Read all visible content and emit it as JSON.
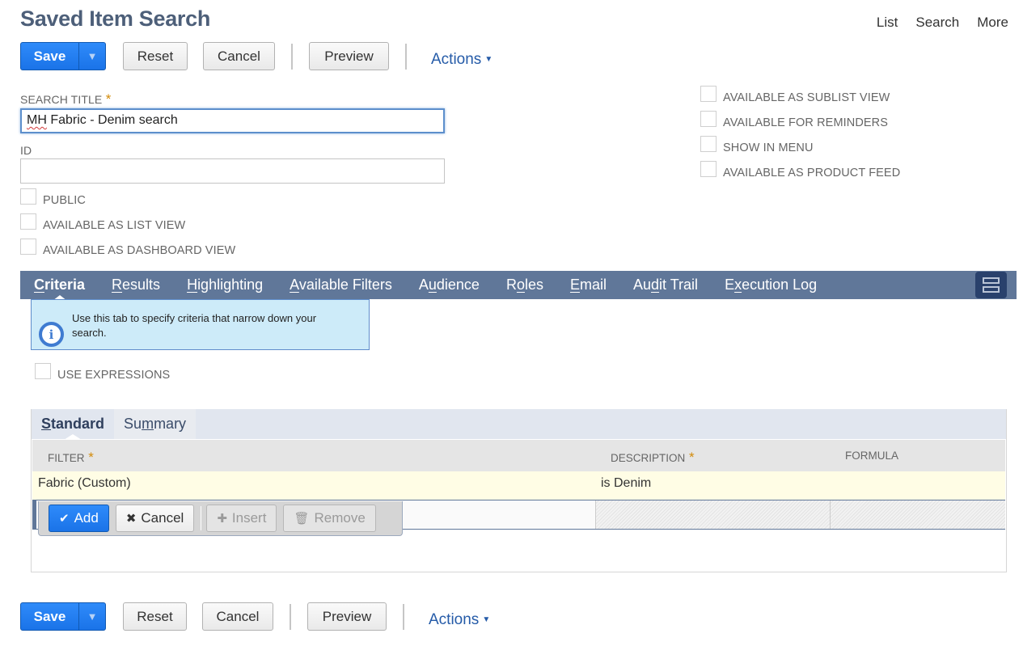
{
  "page": {
    "title": "Saved Item Search"
  },
  "top_links": [
    "List",
    "Search",
    "More"
  ],
  "toolbar": {
    "save_label": "Save",
    "reset_label": "Reset",
    "cancel_label": "Cancel",
    "preview_label": "Preview",
    "actions_label": "Actions"
  },
  "form": {
    "search_title_label": "SEARCH TITLE",
    "search_title_value": "MH Fabric - Denim search",
    "search_title_misspelled": "MH",
    "search_title_rest": " Fabric - Denim search",
    "id_label": "ID",
    "id_value": "",
    "left_checkboxes": [
      {
        "label": "PUBLIC",
        "checked": false
      },
      {
        "label": "AVAILABLE AS LIST VIEW",
        "checked": false
      },
      {
        "label": "AVAILABLE AS DASHBOARD VIEW",
        "checked": false
      }
    ],
    "right_checkboxes": [
      {
        "label": "AVAILABLE AS SUBLIST VIEW",
        "checked": false
      },
      {
        "label": "AVAILABLE FOR REMINDERS",
        "checked": false
      },
      {
        "label": "SHOW IN MENU",
        "checked": false
      },
      {
        "label": "AVAILABLE AS PRODUCT FEED",
        "checked": false
      }
    ]
  },
  "tabs": [
    {
      "pre": "",
      "key": "C",
      "post": "riteria",
      "active": true
    },
    {
      "pre": "",
      "key": "R",
      "post": "esults",
      "active": false
    },
    {
      "pre": "",
      "key": "H",
      "post": "ighlighting",
      "active": false
    },
    {
      "pre": "",
      "key": "A",
      "post": "vailable Filters",
      "active": false
    },
    {
      "pre": "A",
      "key": "u",
      "post": "dience",
      "active": false
    },
    {
      "pre": "R",
      "key": "o",
      "post": "les",
      "active": false
    },
    {
      "pre": "",
      "key": "E",
      "post": "mail",
      "active": false
    },
    {
      "pre": "Au",
      "key": "d",
      "post": "it Trail",
      "active": false
    },
    {
      "pre": "E",
      "key": "x",
      "post": "ecution Log",
      "active": false
    }
  ],
  "info": {
    "text": "Use this tab to specify criteria that narrow down your search."
  },
  "use_expressions": {
    "label": "USE EXPRESSIONS",
    "checked": false
  },
  "subtabs": [
    {
      "pre": "",
      "key": "S",
      "post": "tandard",
      "active": true
    },
    {
      "pre": "Su",
      "key": "m",
      "post": "mary",
      "active": false
    }
  ],
  "grid": {
    "headers": {
      "filter": "FILTER",
      "description": "DESCRIPTION",
      "formula": "FORMULA"
    },
    "rows": [
      {
        "filter": "Fabric (Custom)",
        "description": "is Denim",
        "formula": ""
      }
    ],
    "edit_row": {
      "filter_value": ""
    }
  },
  "grid_buttons": {
    "add": "Add",
    "cancel": "Cancel",
    "insert": "Insert",
    "remove": "Remove"
  }
}
